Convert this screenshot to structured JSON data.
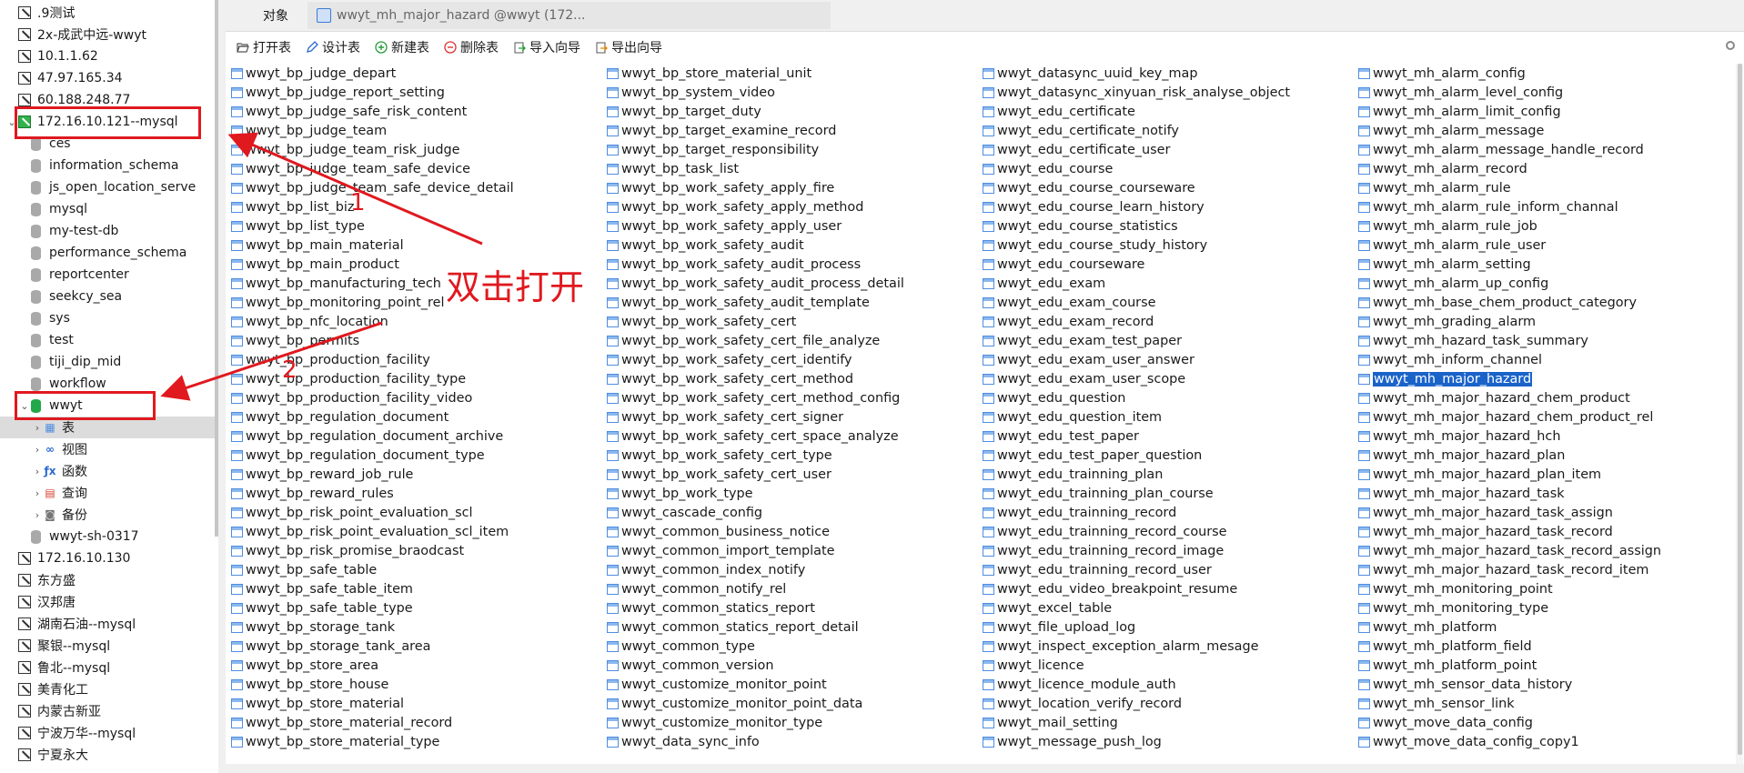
{
  "sidebar": {
    "connections_top": [
      ".9测试",
      "2x-成武中远-wwyt",
      "10.1.1.62",
      "47.97.165.34",
      "60.188.248.77"
    ],
    "active_connection": "172.16.10.121--mysql",
    "databases": [
      "ces",
      "information_schema",
      "js_open_location_serve",
      "mysql",
      "my-test-db",
      "performance_schema",
      "reportcenter",
      "seekcy_sea",
      "sys",
      "test",
      "tiji_dip_mid",
      "workflow"
    ],
    "active_db": "wwyt",
    "db_children": [
      {
        "label": "表",
        "icon": "table-icon"
      },
      {
        "label": "视图",
        "icon": "view-icon"
      },
      {
        "label": "函数",
        "icon": "function-icon"
      },
      {
        "label": "查询",
        "icon": "query-icon"
      },
      {
        "label": "备份",
        "icon": "backup-icon"
      }
    ],
    "db_after": "wwyt-sh-0317",
    "connections_bottom": [
      "172.16.10.130",
      "东方盛",
      "汉邦唐",
      "湖南石油--mysql",
      "聚银--mysql",
      "鲁北--mysql",
      "美青化工",
      "内蒙古新亚",
      "宁波万华--mysql",
      "宁夏永大"
    ]
  },
  "tabs": {
    "objects": "对象",
    "active": "wwyt_mh_major_hazard @wwyt (172..."
  },
  "toolbar": {
    "open": "打开表",
    "design": "设计表",
    "new": "新建表",
    "delete": "删除表",
    "import": "导入向导",
    "export": "导出向导"
  },
  "tables": {
    "col1": [
      "wwyt_bp_judge_depart",
      "wwyt_bp_judge_report_setting",
      "wwyt_bp_judge_safe_risk_content",
      "wwyt_bp_judge_team",
      "wwyt_bp_judge_team_risk_judge",
      "wwyt_bp_judge_team_safe_device",
      "wwyt_bp_judge_team_safe_device_detail",
      "wwyt_bp_list_biz",
      "wwyt_bp_list_type",
      "wwyt_bp_main_material",
      "wwyt_bp_main_product",
      "wwyt_bp_manufacturing_tech",
      "wwyt_bp_monitoring_point_rel",
      "wwyt_bp_nfc_location",
      "wwyt_bp_permits",
      "wwyt_bp_production_facility",
      "wwyt_bp_production_facility_type",
      "wwyt_bp_production_facility_video",
      "wwyt_bp_regulation_document",
      "wwyt_bp_regulation_document_archive",
      "wwyt_bp_regulation_document_type",
      "wwyt_bp_reward_job_rule",
      "wwyt_bp_reward_rules",
      "wwyt_bp_risk_point_evaluation_scl",
      "wwyt_bp_risk_point_evaluation_scl_item",
      "wwyt_bp_risk_promise_braodcast",
      "wwyt_bp_safe_table",
      "wwyt_bp_safe_table_item",
      "wwyt_bp_safe_table_type",
      "wwyt_bp_storage_tank",
      "wwyt_bp_storage_tank_area",
      "wwyt_bp_store_area",
      "wwyt_bp_store_house",
      "wwyt_bp_store_material",
      "wwyt_bp_store_material_record",
      "wwyt_bp_store_material_type"
    ],
    "col2": [
      "wwyt_bp_store_material_unit",
      "wwyt_bp_system_video",
      "wwyt_bp_target_duty",
      "wwyt_bp_target_examine_record",
      "wwyt_bp_target_responsibility",
      "wwyt_bp_task_list",
      "wwyt_bp_work_safety_apply_fire",
      "wwyt_bp_work_safety_apply_method",
      "wwyt_bp_work_safety_apply_user",
      "wwyt_bp_work_safety_audit",
      "wwyt_bp_work_safety_audit_process",
      "wwyt_bp_work_safety_audit_process_detail",
      "wwyt_bp_work_safety_audit_template",
      "wwyt_bp_work_safety_cert",
      "wwyt_bp_work_safety_cert_file_analyze",
      "wwyt_bp_work_safety_cert_identify",
      "wwyt_bp_work_safety_cert_method",
      "wwyt_bp_work_safety_cert_method_config",
      "wwyt_bp_work_safety_cert_signer",
      "wwyt_bp_work_safety_cert_space_analyze",
      "wwyt_bp_work_safety_cert_type",
      "wwyt_bp_work_safety_cert_user",
      "wwyt_bp_work_type",
      "wwyt_cascade_config",
      "wwyt_common_business_notice",
      "wwyt_common_import_template",
      "wwyt_common_index_notify",
      "wwyt_common_notify_rel",
      "wwyt_common_statics_report",
      "wwyt_common_statics_report_detail",
      "wwyt_common_type",
      "wwyt_common_version",
      "wwyt_customize_monitor_point",
      "wwyt_customize_monitor_point_data",
      "wwyt_customize_monitor_type",
      "wwyt_data_sync_info"
    ],
    "col3": [
      "wwyt_datasync_uuid_key_map",
      "wwyt_datasync_xinyuan_risk_analyse_object",
      "wwyt_edu_certificate",
      "wwyt_edu_certificate_notify",
      "wwyt_edu_certificate_user",
      "wwyt_edu_course",
      "wwyt_edu_course_courseware",
      "wwyt_edu_course_learn_history",
      "wwyt_edu_course_statistics",
      "wwyt_edu_course_study_history",
      "wwyt_edu_courseware",
      "wwyt_edu_exam",
      "wwyt_edu_exam_course",
      "wwyt_edu_exam_record",
      "wwyt_edu_exam_test_paper",
      "wwyt_edu_exam_user_answer",
      "wwyt_edu_exam_user_scope",
      "wwyt_edu_question",
      "wwyt_edu_question_item",
      "wwyt_edu_test_paper",
      "wwyt_edu_test_paper_question",
      "wwyt_edu_trainning_plan",
      "wwyt_edu_trainning_plan_course",
      "wwyt_edu_trainning_record",
      "wwyt_edu_trainning_record_course",
      "wwyt_edu_trainning_record_image",
      "wwyt_edu_trainning_record_user",
      "wwyt_edu_video_breakpoint_resume",
      "wwyt_excel_table",
      "wwyt_file_upload_log",
      "wwyt_inspect_exception_alarm_mesage",
      "wwyt_licence",
      "wwyt_licence_module_auth",
      "wwyt_location_verify_record",
      "wwyt_mail_setting",
      "wwyt_message_push_log"
    ],
    "col4": [
      "wwyt_mh_alarm_config",
      "wwyt_mh_alarm_level_config",
      "wwyt_mh_alarm_limit_config",
      "wwyt_mh_alarm_message",
      "wwyt_mh_alarm_message_handle_record",
      "wwyt_mh_alarm_record",
      "wwyt_mh_alarm_rule",
      "wwyt_mh_alarm_rule_inform_channal",
      "wwyt_mh_alarm_rule_job",
      "wwyt_mh_alarm_rule_user",
      "wwyt_mh_alarm_setting",
      "wwyt_mh_alarm_up_config",
      "wwyt_mh_base_chem_product_category",
      "wwyt_mh_grading_alarm",
      "wwyt_mh_hazard_task_summary",
      "wwyt_mh_inform_channel",
      "wwyt_mh_major_hazard",
      "wwyt_mh_major_hazard_chem_product",
      "wwyt_mh_major_hazard_chem_product_rel",
      "wwyt_mh_major_hazard_hch",
      "wwyt_mh_major_hazard_plan",
      "wwyt_mh_major_hazard_plan_item",
      "wwyt_mh_major_hazard_task",
      "wwyt_mh_major_hazard_task_assign",
      "wwyt_mh_major_hazard_task_record",
      "wwyt_mh_major_hazard_task_record_assign",
      "wwyt_mh_major_hazard_task_record_item",
      "wwyt_mh_monitoring_point",
      "wwyt_mh_monitoring_type",
      "wwyt_mh_platform",
      "wwyt_mh_platform_field",
      "wwyt_mh_platform_point",
      "wwyt_mh_sensor_data_history",
      "wwyt_mh_sensor_link",
      "wwyt_move_data_config",
      "wwyt_move_data_config_copy1"
    ],
    "selected": "wwyt_mh_major_hazard"
  },
  "annotations": {
    "instruction": "双击打开",
    "step1": "1",
    "step2": "2",
    "color": "#e0191f"
  }
}
